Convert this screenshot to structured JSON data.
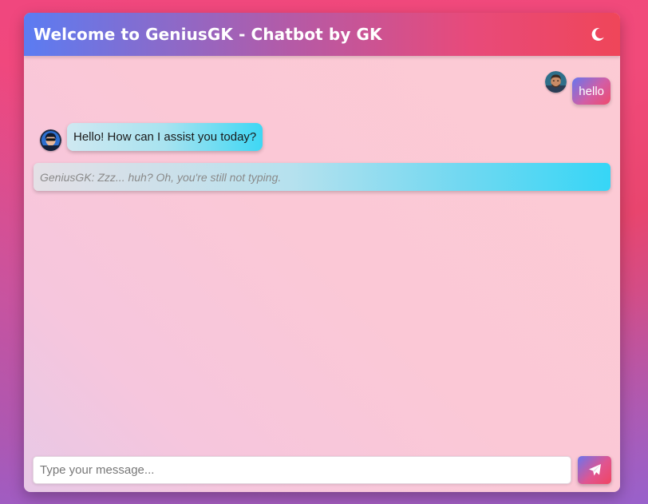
{
  "header": {
    "title": "Welcome to GeniusGK - Chatbot by GK",
    "theme_icon": "moon-icon"
  },
  "messages": [
    {
      "sender": "user",
      "text": "hello",
      "avatar": "user-avatar"
    },
    {
      "sender": "bot",
      "text": "Hello! How can I assist you today?",
      "avatar": "bot-avatar"
    }
  ],
  "typing_notice": "GeniusGK: Zzz... huh? Oh, you're still not typing.",
  "input": {
    "placeholder": "Type your message...",
    "value": ""
  },
  "send_button": {
    "icon": "paper-plane-icon"
  },
  "colors": {
    "header_start": "#5b7cf2",
    "header_end": "#ef4659",
    "bot_bubble_accent": "#36d6f6",
    "user_bubble_accent": "#ef4a6d",
    "page_background": "#f0477e"
  }
}
